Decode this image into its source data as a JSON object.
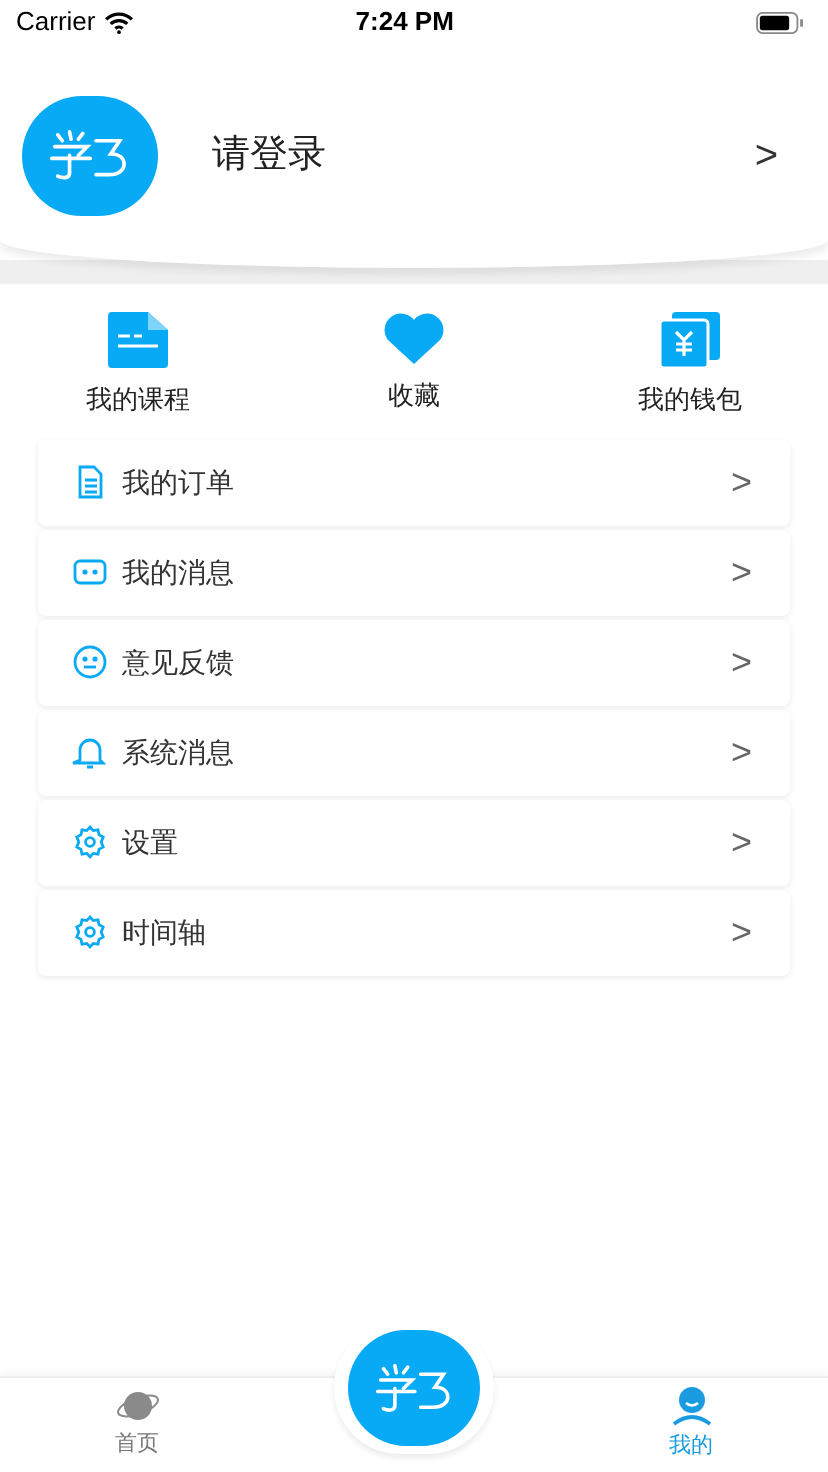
{
  "status_bar": {
    "carrier": "Carrier",
    "time": "7:24 PM"
  },
  "profile": {
    "login_prompt": "请登录",
    "chevron": ">"
  },
  "shortcuts": [
    {
      "kind": "course",
      "label": "我的课程"
    },
    {
      "kind": "favorite",
      "label": "收藏"
    },
    {
      "kind": "wallet",
      "label": "我的钱包"
    }
  ],
  "menu": [
    {
      "kind": "order",
      "label": "我的订单",
      "chevron": ">"
    },
    {
      "kind": "message",
      "label": "我的消息",
      "chevron": ">"
    },
    {
      "kind": "feedback",
      "label": "意见反馈",
      "chevron": ">"
    },
    {
      "kind": "bell",
      "label": "系统消息",
      "chevron": ">"
    },
    {
      "kind": "gear",
      "label": "设置",
      "chevron": ">"
    },
    {
      "kind": "gear",
      "label": "时间轴",
      "chevron": ">"
    }
  ],
  "tab_bar": [
    {
      "kind": "home",
      "label": "首页",
      "selected": false
    },
    {
      "kind": "me",
      "label": "我的",
      "selected": true
    }
  ]
}
